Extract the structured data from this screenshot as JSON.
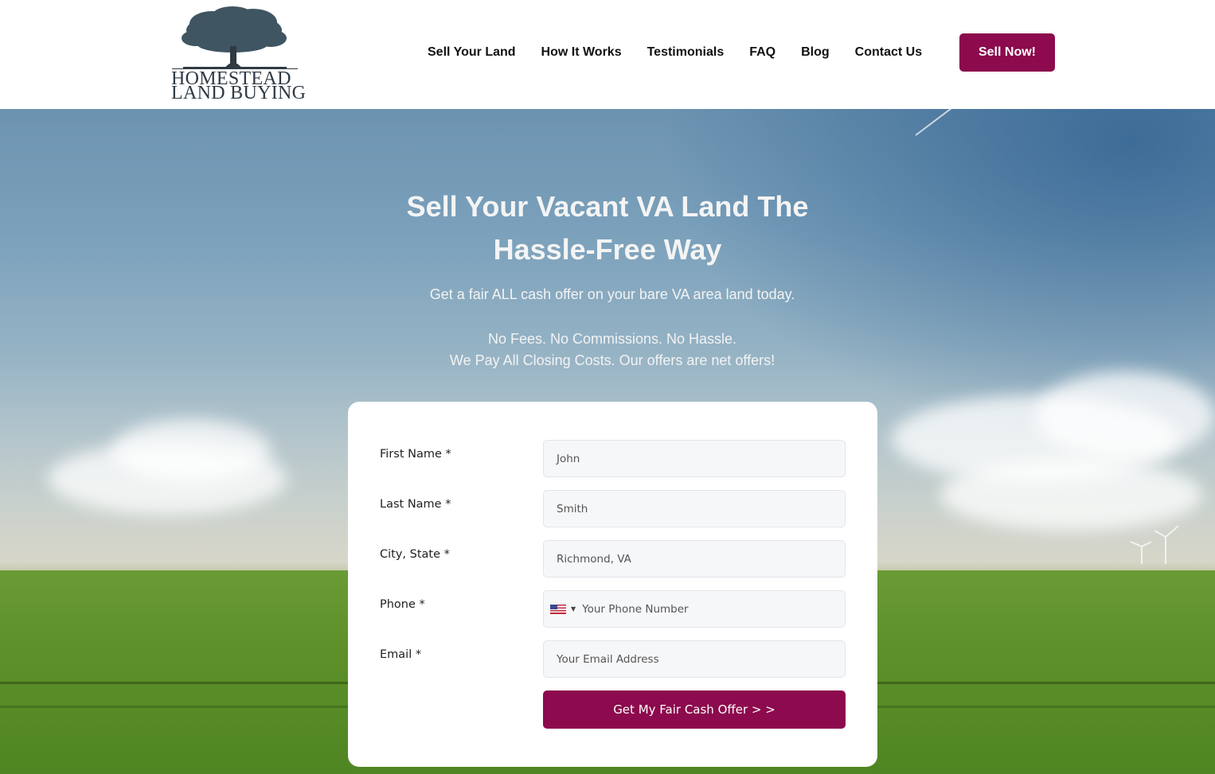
{
  "logo": {
    "line1": "HOMESTEAD",
    "line2": "LAND BUYING",
    "icon": "oak-tree-icon"
  },
  "nav": {
    "items": [
      {
        "label": "Sell Your Land"
      },
      {
        "label": "How It Works"
      },
      {
        "label": "Testimonials"
      },
      {
        "label": "FAQ"
      },
      {
        "label": "Blog"
      },
      {
        "label": "Contact Us"
      }
    ],
    "cta": "Sell Now!"
  },
  "hero": {
    "title_line1": "Sell Your Vacant VA Land The",
    "title_line2": "Hassle-Free Way",
    "subtitle": "Get a fair ALL cash offer on your bare VA area land today.",
    "line2": "No Fees. No Commissions. No Hassle.",
    "line3": "We Pay All Closing Costs. Our offers are net offers!"
  },
  "form": {
    "fields": [
      {
        "label": "First Name *",
        "placeholder": "John"
      },
      {
        "label": "Last Name *",
        "placeholder": "Smith"
      },
      {
        "label": "City, State *",
        "placeholder": "Richmond, VA"
      },
      {
        "label": "Phone *",
        "placeholder": "Your Phone Number",
        "country_icon": "us-flag-icon"
      },
      {
        "label": "Email *",
        "placeholder": "Your Email Address"
      }
    ],
    "submit": "Get My Fair Cash Offer > >"
  },
  "colors": {
    "brand": "#8c0a4d",
    "text": "#111111",
    "input_bg": "#f6f7f9"
  }
}
